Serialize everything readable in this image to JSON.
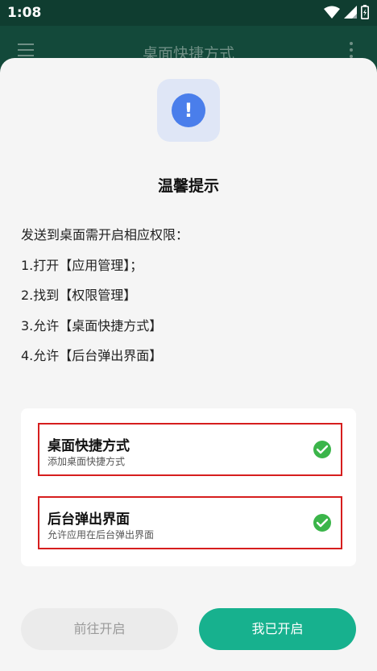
{
  "status_bar": {
    "time": "1:08"
  },
  "app_bar": {
    "title": "桌面快捷方式"
  },
  "dialog": {
    "title": "温馨提示",
    "alert_glyph": "!",
    "steps": [
      "发送到桌面需开启相应权限：",
      "1.打开【应用管理】；",
      "2.找到【权限管理】",
      "3.允许【桌面快捷方式】",
      "4.允许【后台弹出界面】"
    ],
    "permissions": [
      {
        "name": "桌面快捷方式",
        "desc": "添加桌面快捷方式",
        "status_icon": "check-icon"
      },
      {
        "name": "后台弹出界面",
        "desc": "允许应用在后台弹出界面",
        "status_icon": "check-icon"
      }
    ],
    "buttons": {
      "later": "前往开启",
      "done": "我已开启"
    }
  },
  "colors": {
    "accent_green": "#17b18e",
    "check_green": "#3bb54a",
    "alert_blue": "#4a7eeb",
    "highlight_red": "#d61e1e"
  }
}
